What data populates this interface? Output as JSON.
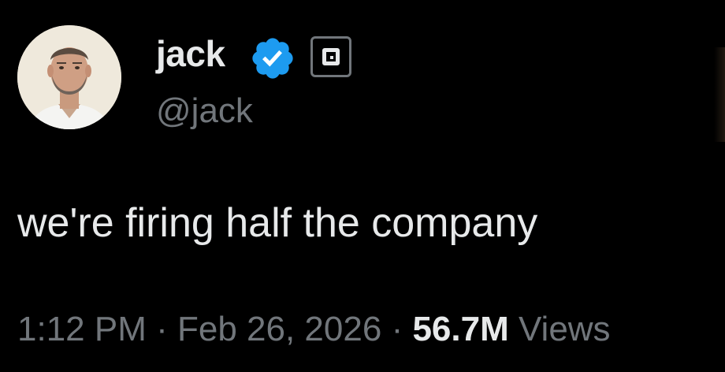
{
  "user": {
    "display_name": "jack",
    "handle": "@jack",
    "verified": true,
    "verified_color": "#1d9bf0",
    "affiliate_icon": "square-logo-icon"
  },
  "tweet": {
    "text": "we're firing half the company"
  },
  "meta": {
    "time": "1:12 PM",
    "separator": "·",
    "date": "Feb 26, 2026",
    "views_count": "56.7M",
    "views_label": "Views"
  },
  "colors": {
    "background": "#000000",
    "primary_text": "#e7e9ea",
    "secondary_text": "#71767b",
    "verified_blue": "#1d9bf0"
  }
}
